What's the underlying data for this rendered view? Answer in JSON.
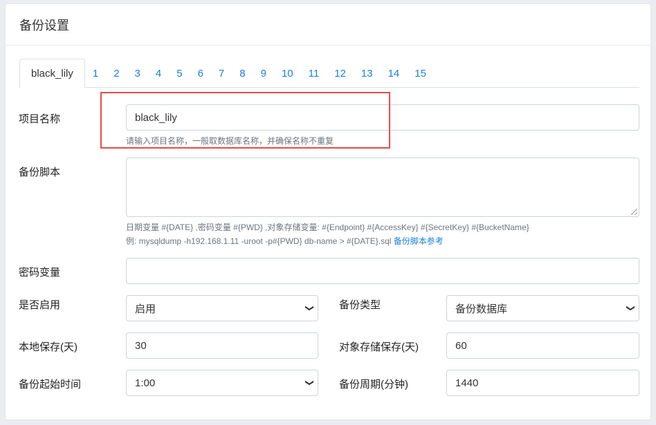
{
  "header": {
    "title": "备份设置"
  },
  "tabs": [
    "black_lily",
    "1",
    "2",
    "3",
    "4",
    "5",
    "6",
    "7",
    "8",
    "9",
    "10",
    "11",
    "12",
    "13",
    "14",
    "15"
  ],
  "form": {
    "project_name": {
      "label": "项目名称",
      "value": "black_lily",
      "help": "请输入项目名称，一般取数据库名称，并确保名称不重复"
    },
    "backup_script": {
      "label": "备份脚本",
      "value": "",
      "help_line1": "日期变量 #{DATE} ,密码变量 #{PWD} ,对象存储变量: #{Endpoint} #{AccessKey} #{SecretKey} #{BucketName}",
      "help_line2": "例: mysqldump -h192.168.1.11 -uroot -p#{PWD} db-name > #{DATE}.sql",
      "help_link": "备份脚本参考"
    },
    "password_var": {
      "label": "密码变量",
      "value": ""
    },
    "enabled": {
      "label": "是否启用",
      "value": "启用"
    },
    "backup_type": {
      "label": "备份类型",
      "value": "备份数据库"
    },
    "local_retention": {
      "label": "本地保存(天)",
      "value": "30"
    },
    "oss_retention": {
      "label": "对象存储保存(天)",
      "value": "60"
    },
    "start_time": {
      "label": "备份起始时间",
      "value": "1:00"
    },
    "period": {
      "label": "备份周期(分钟)",
      "value": "1440"
    }
  },
  "icons": {
    "select_arrow": "chevron-down-icon",
    "resize": "resize-grip-icon"
  },
  "colors": {
    "link": "#1c7fe0",
    "highlight": "#e54b4b"
  }
}
